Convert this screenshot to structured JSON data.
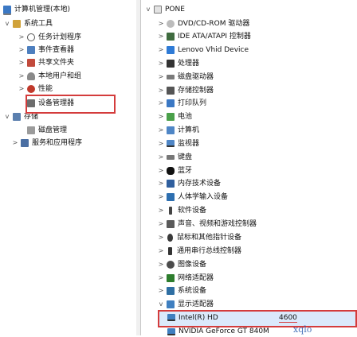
{
  "left_tree": {
    "computer_mgmt": "计算机管理(本地)",
    "system_tools": "系统工具",
    "task_scheduler": "任务计划程序",
    "event_viewer": "事件查看器",
    "shared_folders": "共享文件夹",
    "local_users": "本地用户和组",
    "performance": "性能",
    "device_manager": "设备管理器",
    "storage": "存储",
    "disk_mgmt": "磁盘管理",
    "services_apps": "服务和应用程序"
  },
  "right_tree": {
    "root": "PONE",
    "items": [
      "DVD/CD-ROM 驱动器",
      "IDE ATA/ATAPI 控制器",
      "Lenovo Vhid Device",
      "处理器",
      "磁盘驱动器",
      "存储控制器",
      "打印队列",
      "电池",
      "计算机",
      "监视器",
      "键盘",
      "蓝牙",
      "内存技术设备",
      "人体学输入设备",
      "软件设备",
      "声音、视频和游戏控制器",
      "鼠标和其他指针设备",
      "通用串行总线控制器",
      "图像设备",
      "网络适配器",
      "系统设备",
      "显示适配器"
    ],
    "display_children": {
      "intel": "Intel(R) HD",
      "intel_suffix": "4600",
      "nvidia": "NVIDIA GeForce GT 840M"
    }
  },
  "watermark": "xqlo"
}
